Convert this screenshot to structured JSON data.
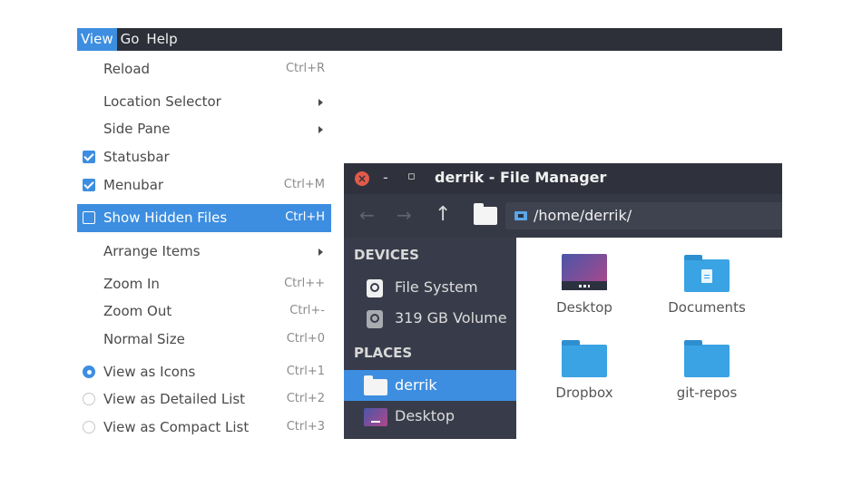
{
  "menubar": {
    "items": [
      {
        "label": "View",
        "active": true
      },
      {
        "label": "Go",
        "active": false
      },
      {
        "label": "Help",
        "active": false
      }
    ]
  },
  "view_menu": {
    "items": [
      {
        "label": "Reload",
        "accel": "Ctrl+R",
        "kind": "plain"
      },
      {
        "label": "Location Selector",
        "accel": "",
        "kind": "submenu"
      },
      {
        "label": "Side Pane",
        "accel": "",
        "kind": "submenu"
      },
      {
        "label": "Statusbar",
        "accel": "",
        "kind": "check",
        "checked": true
      },
      {
        "label": "Menubar",
        "accel": "Ctrl+M",
        "kind": "check",
        "checked": true
      },
      {
        "label": "Show Hidden Files",
        "accel": "Ctrl+H",
        "kind": "check",
        "checked": false,
        "highlighted": true
      },
      {
        "label": "Arrange Items",
        "accel": "",
        "kind": "submenu"
      },
      {
        "label": "Zoom In",
        "accel": "Ctrl++",
        "kind": "plain"
      },
      {
        "label": "Zoom Out",
        "accel": "Ctrl+-",
        "kind": "plain"
      },
      {
        "label": "Normal Size",
        "accel": "Ctrl+0",
        "kind": "plain"
      },
      {
        "label": "View as Icons",
        "accel": "Ctrl+1",
        "kind": "radio",
        "checked": true
      },
      {
        "label": "View as Detailed List",
        "accel": "Ctrl+2",
        "kind": "radio",
        "checked": false
      },
      {
        "label": "View as Compact List",
        "accel": "Ctrl+3",
        "kind": "radio",
        "checked": false
      }
    ]
  },
  "file_manager": {
    "window_title": "derrik - File Manager",
    "close_glyph": "×",
    "minimize_glyph": "-",
    "maximize_glyph": "▫",
    "toolbar": {
      "back_glyph": "←",
      "forward_glyph": "→",
      "up_glyph": "↑",
      "path": "/home/derrik/"
    },
    "sidebar": {
      "devices_header": "DEVICES",
      "devices": [
        {
          "label": "File System",
          "icon": "drive-icon"
        },
        {
          "label": "319 GB Volume",
          "icon": "drive-icon"
        }
      ],
      "places_header": "PLACES",
      "places": [
        {
          "label": "derrik",
          "icon": "home-folder-icon",
          "selected": true
        },
        {
          "label": "Desktop",
          "icon": "desktop-icon",
          "selected": false
        }
      ]
    },
    "items": [
      {
        "label": "Desktop",
        "icon": "desktop-icon"
      },
      {
        "label": "Documents",
        "icon": "documents-folder-icon"
      },
      {
        "label": "Dropbox",
        "icon": "folder-icon"
      },
      {
        "label": "git-repos",
        "icon": "folder-icon"
      }
    ]
  },
  "colors": {
    "accent": "#3d8ee0",
    "menubar_bg": "#2d3039",
    "sidebar_bg": "#383c4a",
    "folder": "#3aa3e3"
  }
}
